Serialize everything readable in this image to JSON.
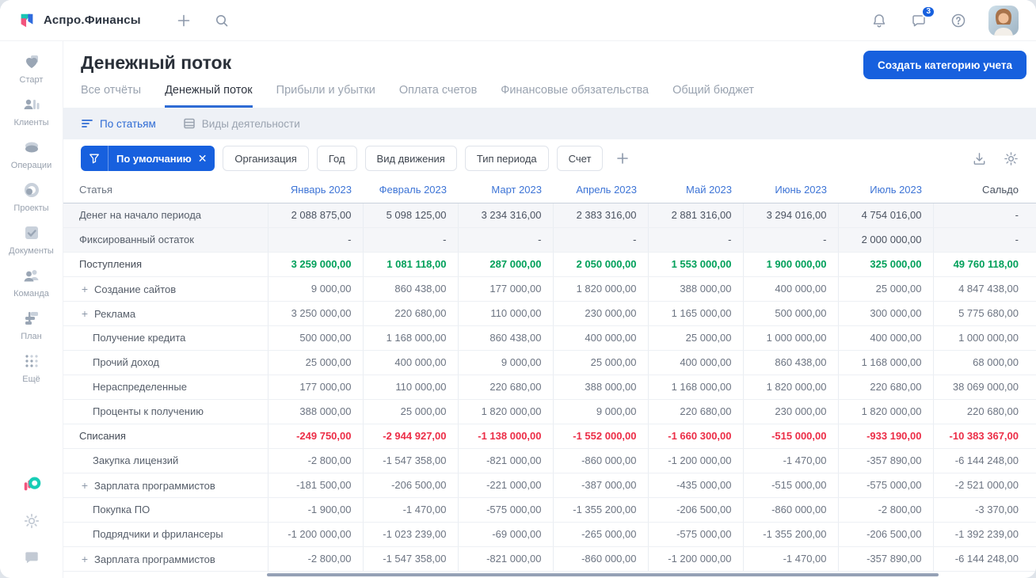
{
  "topbar": {
    "brand": "Аспро.Финансы",
    "chat_badge": "3"
  },
  "sidebar": {
    "items": [
      {
        "id": "start",
        "label": "Старт"
      },
      {
        "id": "clients",
        "label": "Клиенты"
      },
      {
        "id": "operations",
        "label": "Операции"
      },
      {
        "id": "projects",
        "label": "Проекты"
      },
      {
        "id": "documents",
        "label": "Документы"
      },
      {
        "id": "team",
        "label": "Команда"
      },
      {
        "id": "plan",
        "label": "План"
      },
      {
        "id": "more",
        "label": "Ещё"
      }
    ]
  },
  "page": {
    "title": "Денежный поток",
    "create_button": "Создать категорию учета",
    "tabs": [
      {
        "id": "all-reports",
        "label": "Все отчёты",
        "active": false
      },
      {
        "id": "cash-flow",
        "label": "Денежный поток",
        "active": true
      },
      {
        "id": "profit-loss",
        "label": "Прибыли и убытки",
        "active": false
      },
      {
        "id": "invoices",
        "label": "Оплата счетов",
        "active": false
      },
      {
        "id": "liabilities",
        "label": "Финансовые обязательства",
        "active": false
      },
      {
        "id": "budget",
        "label": "Общий бюджет",
        "active": false
      }
    ],
    "subtabs": [
      {
        "id": "by-items",
        "label": "По статьям",
        "active": true
      },
      {
        "id": "activity-types",
        "label": "Виды деятельности",
        "active": false
      }
    ]
  },
  "filters": {
    "active": {
      "label": "По умолчанию"
    },
    "chips": [
      {
        "id": "organization",
        "label": "Организация"
      },
      {
        "id": "year",
        "label": "Год"
      },
      {
        "id": "movement-type",
        "label": "Вид движения"
      },
      {
        "id": "period-type",
        "label": "Тип периода"
      },
      {
        "id": "account",
        "label": "Счет"
      }
    ]
  },
  "table": {
    "columns": [
      "Статья",
      "Январь 2023",
      "Февраль 2023",
      "Март 2023",
      "Апрель 2023",
      "Май 2023",
      "Июнь 2023",
      "Июль 2023",
      "Сальдо"
    ],
    "rows": [
      {
        "label": "Денег на начало периода",
        "type": "opening",
        "plus": false,
        "indent": false,
        "values": [
          "2 088 875,00",
          "5 098 125,00",
          "3 234 316,00",
          "2 383 316,00",
          "2 881 316,00",
          "3 294 016,00",
          "4 754 016,00",
          "-"
        ]
      },
      {
        "label": "Фиксированный остаток",
        "type": "opening",
        "plus": false,
        "indent": false,
        "values": [
          "-",
          "-",
          "-",
          "-",
          "-",
          "-",
          "2 000 000,00",
          "-"
        ]
      },
      {
        "label": "Поступления",
        "type": "income_total",
        "plus": false,
        "indent": false,
        "values": [
          "3 259 000,00",
          "1 081 118,00",
          "287 000,00",
          "2 050 000,00",
          "1 553 000,00",
          "1 900 000,00",
          "325 000,00",
          "49 760 118,00"
        ]
      },
      {
        "label": "Создание сайтов",
        "type": "detail",
        "plus": true,
        "indent": false,
        "values": [
          "9 000,00",
          "860 438,00",
          "177 000,00",
          "1 820 000,00",
          "388 000,00",
          "400 000,00",
          "25 000,00",
          "4 847 438,00"
        ]
      },
      {
        "label": "Реклама",
        "type": "detail",
        "plus": true,
        "indent": false,
        "values": [
          "3 250 000,00",
          "220 680,00",
          "110 000,00",
          "230 000,00",
          "1 165 000,00",
          "500 000,00",
          "300 000,00",
          "5 775 680,00"
        ]
      },
      {
        "label": "Получение кредита",
        "type": "detail",
        "plus": false,
        "indent": true,
        "values": [
          "500 000,00",
          "1 168 000,00",
          "860 438,00",
          "400 000,00",
          "25 000,00",
          "1 000 000,00",
          "400 000,00",
          "1 000 000,00"
        ]
      },
      {
        "label": "Прочий доход",
        "type": "detail",
        "plus": false,
        "indent": true,
        "values": [
          "25 000,00",
          "400 000,00",
          "9 000,00",
          "25 000,00",
          "400 000,00",
          "860 438,00",
          "1 168 000,00",
          "68 000,00"
        ]
      },
      {
        "label": "Нераспределенные",
        "type": "detail",
        "plus": false,
        "indent": true,
        "values": [
          "177 000,00",
          "110 000,00",
          "220 680,00",
          "388 000,00",
          "1 168 000,00",
          "1 820 000,00",
          "220 680,00",
          "38 069 000,00"
        ]
      },
      {
        "label": "Проценты к получению",
        "type": "detail",
        "plus": false,
        "indent": true,
        "values": [
          "388 000,00",
          "25 000,00",
          "1 820 000,00",
          "9 000,00",
          "220 680,00",
          "230 000,00",
          "1 820 000,00",
          "220 680,00"
        ]
      },
      {
        "label": "Списания",
        "type": "expense_total",
        "plus": false,
        "indent": false,
        "values": [
          "-249 750,00",
          "-2 944 927,00",
          "-1 138 000,00",
          "-1 552 000,00",
          "-1 660 300,00",
          "-515 000,00",
          "-933 190,00",
          "-10 383 367,00"
        ]
      },
      {
        "label": "Закупка лицензий",
        "type": "detail",
        "plus": false,
        "indent": true,
        "values": [
          "-2 800,00",
          "-1 547 358,00",
          "-821 000,00",
          "-860 000,00",
          "-1 200 000,00",
          "-1 470,00",
          "-357 890,00",
          "-6 144 248,00"
        ]
      },
      {
        "label": "Зарплата программистов",
        "type": "detail",
        "plus": true,
        "indent": false,
        "values": [
          "-181 500,00",
          "-206 500,00",
          "-221 000,00",
          "-387 000,00",
          "-435 000,00",
          "-515 000,00",
          "-575 000,00",
          "-2 521 000,00"
        ]
      },
      {
        "label": "Покупка ПО",
        "type": "detail",
        "plus": false,
        "indent": true,
        "values": [
          "-1 900,00",
          "-1 470,00",
          "-575 000,00",
          "-1 355 200,00",
          "-206 500,00",
          "-860 000,00",
          "-2 800,00",
          "-3 370,00"
        ]
      },
      {
        "label": "Подрядчики и фрилансеры",
        "type": "detail",
        "plus": false,
        "indent": true,
        "values": [
          "-1 200 000,00",
          "-1 023 239,00",
          "-69 000,00",
          "-265 000,00",
          "-575 000,00",
          "-1 355 200,00",
          "-206 500,00",
          "-1 392 239,00"
        ]
      },
      {
        "label": "Зарплата программистов",
        "type": "detail",
        "plus": true,
        "indent": false,
        "values": [
          "-2 800,00",
          "-1 547 358,00",
          "-821 000,00",
          "-860 000,00",
          "-1 200 000,00",
          "-1 470,00",
          "-357 890,00",
          "-6 144 248,00"
        ]
      }
    ]
  },
  "colors": {
    "accent": "#1760DE",
    "positive": "#00A05A",
    "negative": "#EC2D47"
  }
}
